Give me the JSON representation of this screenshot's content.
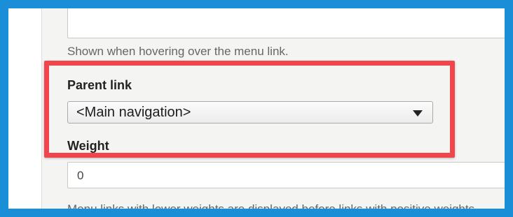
{
  "menu_link_form": {
    "title_description": "Shown when hovering over the menu link.",
    "parent_link": {
      "label": "Parent link",
      "selected_value": "<Main navigation>",
      "dropdown_icon": "triangle-down-icon"
    },
    "weight": {
      "label": "Weight",
      "value": "0",
      "description": "Menu links with lower weights are displayed before links with positive weights."
    }
  },
  "annotation": {
    "highlight_color": "#f0454a"
  },
  "colors": {
    "frame_border": "#1a8fd8",
    "panel_background": "#f4f4f2"
  }
}
